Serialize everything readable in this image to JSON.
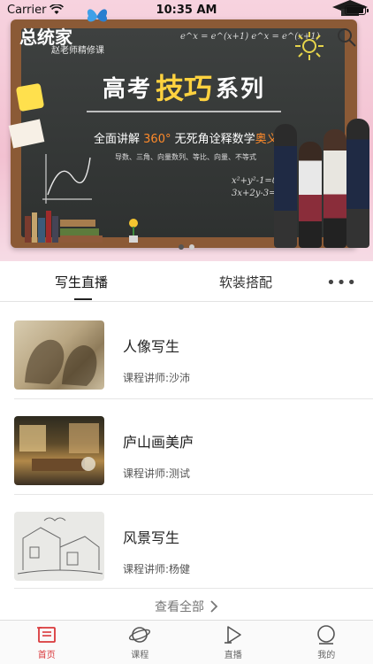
{
  "status_bar": {
    "carrier": "Carrier",
    "time": "10:35 AM",
    "battery_level": 1.0
  },
  "banner": {
    "logo": "总统家",
    "logo_sub": "赵老师精修课",
    "title_pre": "高考",
    "title_key": "技巧",
    "title_post": "系列",
    "line_main_pre": "全面讲解",
    "line_main_hl": "360°",
    "line_main_mid": "无死角诠释数学",
    "line_main_hl2": "奥义",
    "line_main_end": "!",
    "line_sub": "导数、三角、向量数列、等比、向量、不等式",
    "formula_top": "e^x = e^(x+1)  e^x = e^(x+1)",
    "formula_right": "x²+y²-1=0  3x+2y-3=0",
    "accent_color": "#ffd23f",
    "highlight_color": "#ff8a2a",
    "page_count": 2,
    "active_page": 0
  },
  "tabs": {
    "items": [
      "写生直播",
      "软装搭配"
    ],
    "active_index": 0,
    "more_label": "•••"
  },
  "courses": [
    {
      "title": "人像写生",
      "teacher": "课程讲师:沙沛"
    },
    {
      "title": "庐山画美庐",
      "teacher": "课程讲师:测试"
    },
    {
      "title": "风景写生",
      "teacher": "课程讲师:杨健"
    }
  ],
  "view_all": {
    "label": "查看全部",
    "icon": "chevron-right-icon"
  },
  "bottom_nav": {
    "items": [
      {
        "label": "首页",
        "icon": "home-icon",
        "active": true
      },
      {
        "label": "课程",
        "icon": "planet-icon",
        "active": false
      },
      {
        "label": "直播",
        "icon": "play-icon",
        "active": false
      },
      {
        "label": "我的",
        "icon": "profile-icon",
        "active": false
      }
    ],
    "active_color": "#d9383b"
  }
}
